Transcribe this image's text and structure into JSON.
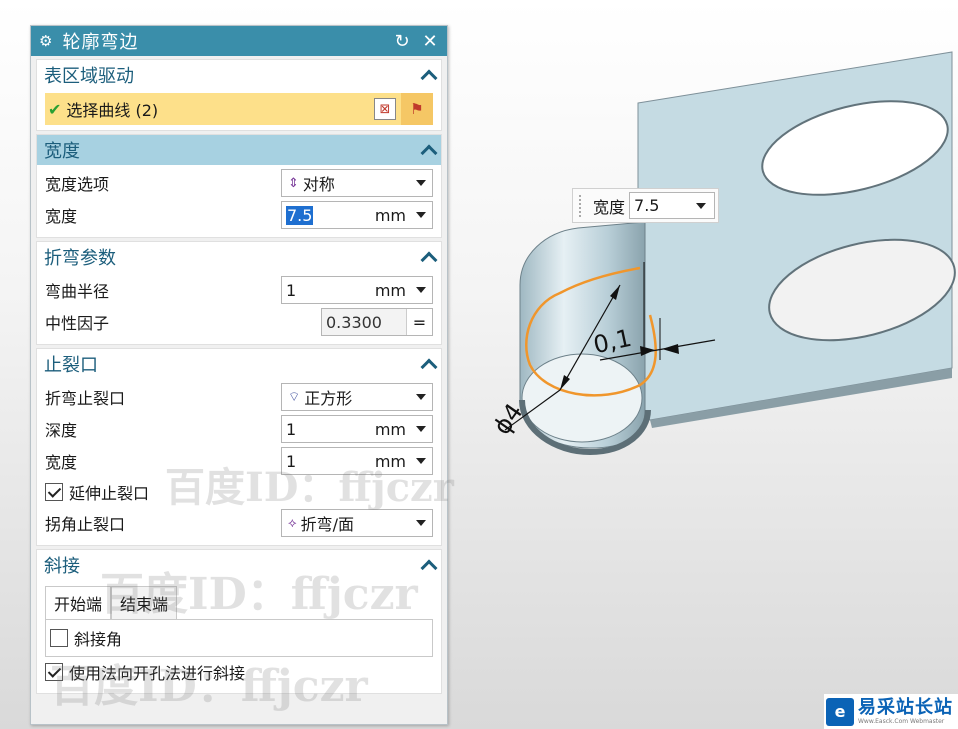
{
  "dialog": {
    "title": "轮廓弯边",
    "reset_icon": "↻",
    "close_icon": "✕"
  },
  "sections": {
    "drive": {
      "title": "表区域驱动",
      "select_label": "选择曲线 (2)"
    },
    "width": {
      "title": "宽度",
      "option_label": "宽度选项",
      "option_value": "对称",
      "width_label": "宽度",
      "width_value": "7.5",
      "width_unit": "mm"
    },
    "bend": {
      "title": "折弯参数",
      "radius_label": "弯曲半径",
      "radius_value": "1",
      "radius_unit": "mm",
      "kfactor_label": "中性因子",
      "kfactor_value": "0.3300",
      "kfactor_eq": "="
    },
    "relief": {
      "title": "止裂口",
      "bend_relief_label": "折弯止裂口",
      "bend_relief_value": "正方形",
      "depth_label": "深度",
      "depth_value": "1",
      "depth_unit": "mm",
      "width_label": "宽度",
      "width_value": "1",
      "width_unit": "mm",
      "extend_label": "延伸止裂口",
      "extend_checked": true,
      "corner_label": "拐角止裂口",
      "corner_value": "折弯/面"
    },
    "miter": {
      "title": "斜接",
      "tab_start": "开始端",
      "tab_end": "结束端",
      "miter_corner_label": "斜接角",
      "miter_corner_checked": false,
      "normal_hole_label": "使用法向开孔法进行斜接",
      "normal_hole_checked": true
    }
  },
  "viewport": {
    "float_label": "宽度",
    "float_value": "7.5",
    "dim_radius": "0,1",
    "dim_diameter": "ϕ4"
  },
  "watermarks": [
    "百度ID：ffjczr",
    "百度ID：ffjczr",
    "百度ID：ffjczr"
  ],
  "logo": {
    "name": "易采站长站",
    "url_text": "Www.Easck.Com Webmaster"
  },
  "colors": {
    "titlebar": "#3a8eaa",
    "section_active": "#a7d1e1",
    "selection": "#fde08a",
    "sheet": "#c5dbe3",
    "curve": "#f0962c"
  }
}
